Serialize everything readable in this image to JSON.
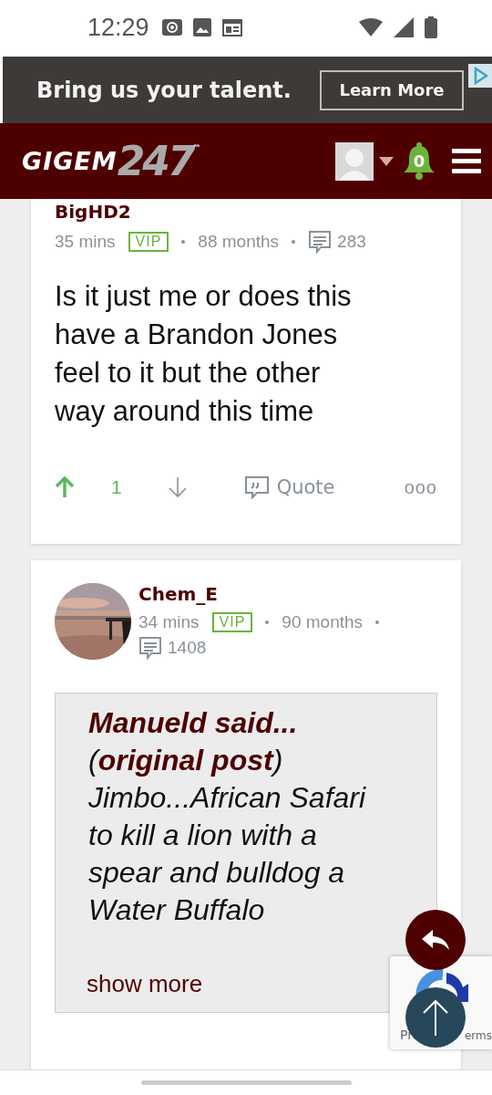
{
  "status_bar": {
    "time": "12:29"
  },
  "ad": {
    "headline": "Bring us your talent.",
    "button": "Learn More"
  },
  "header": {
    "logo_word": "GIGEM",
    "logo_number": "247",
    "logo_mark": "™",
    "notification_count": "0"
  },
  "posts": [
    {
      "author": "BigHD2",
      "time": "35 mins",
      "badge": "VIP",
      "tenure": "88 months",
      "post_count": "283",
      "body": "Is it just me or does this have a Brandon Jones feel to it but the other way around this time",
      "upvoted": true,
      "votes": "1",
      "quote_button": "Quote",
      "more": "ooo"
    },
    {
      "author": "Chem_E",
      "time": "34 mins",
      "badge": "VIP",
      "tenure": "90 months",
      "post_count": "1408",
      "avatar": true,
      "quote": {
        "author": "Manueld said...",
        "source": "(**original post**)",
        "text": "Jimbo...African Safari to kill a lion with a spear and bulldog a Water Buffalo",
        "show_more": "show more"
      }
    }
  ],
  "recaptcha": {
    "left": "Pr",
    "right": "erms"
  }
}
